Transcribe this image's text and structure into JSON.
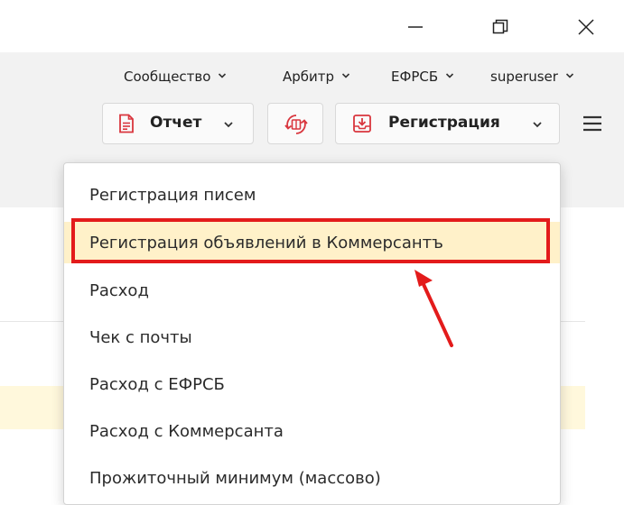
{
  "window_controls": {
    "minimize_icon": "minimize-icon",
    "maximize_icon": "restore-icon",
    "close_icon": "close-icon"
  },
  "topnav": {
    "items": [
      {
        "label": "Сообщество",
        "icon": "chevron-down-icon"
      },
      {
        "label": "Арбитр",
        "icon": "chevron-down-icon"
      },
      {
        "label": "ЕФРСБ",
        "icon": "chevron-down-icon"
      },
      {
        "label": "superuser",
        "icon": "chevron-down-icon"
      }
    ]
  },
  "toolbar": {
    "report": {
      "label": "Отчет",
      "icon": "document-icon"
    },
    "sync": {
      "icon": "sync-icon"
    },
    "registration": {
      "label": "Регистрация",
      "icon": "inbox-download-icon"
    },
    "menu_icon": "hamburger-icon"
  },
  "dropdown": {
    "items": [
      {
        "label": "Регистрация писем"
      },
      {
        "label": "Регистрация объявлений в Коммерсантъ"
      },
      {
        "label": "Расход"
      },
      {
        "label": "Чек с почты"
      },
      {
        "label": "Расход с ЕФРСБ"
      },
      {
        "label": "Расход с Коммерсанта"
      },
      {
        "label": "Прожиточный минимум (массово)"
      }
    ],
    "highlighted_index": 1
  },
  "colors": {
    "accent_red": "#e31b1b",
    "icon_red": "#d9363e",
    "header_bg": "#f2f2f2",
    "highlight_bg": "#fff1c9"
  }
}
